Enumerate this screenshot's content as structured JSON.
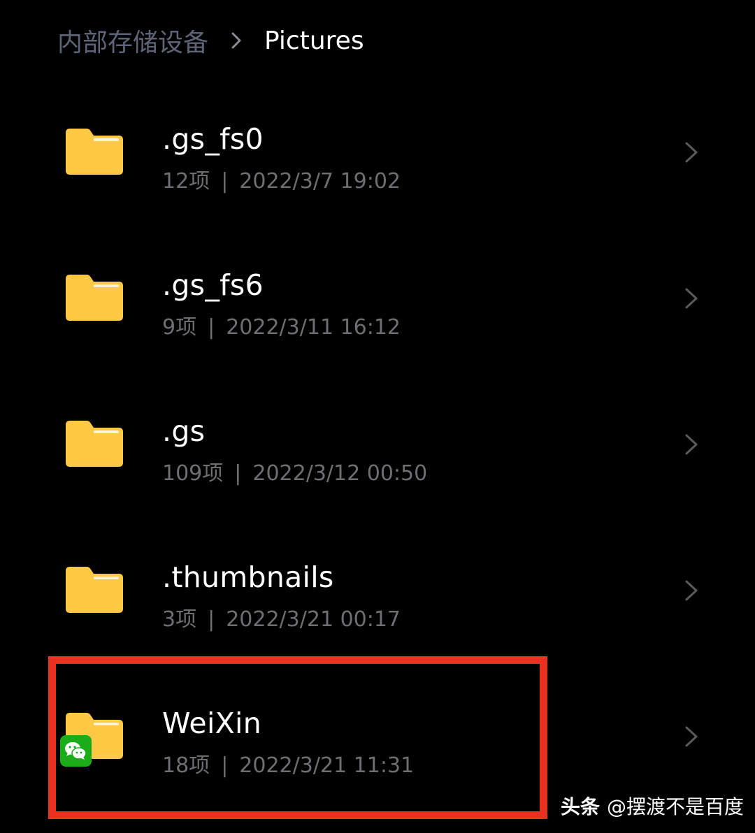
{
  "breadcrumb": {
    "root": "内部存储设备",
    "current": "Pictures"
  },
  "items": [
    {
      "name": ".gs_fs0",
      "count": "12项",
      "separator": "|",
      "date": "2022/3/7 19:02",
      "icon": "folder-icon"
    },
    {
      "name": ".gs_fs6",
      "count": "9项",
      "separator": "|",
      "date": "2022/3/11 16:12",
      "icon": "folder-icon"
    },
    {
      "name": ".gs",
      "count": "109项",
      "separator": "|",
      "date": "2022/3/12 00:50",
      "icon": "folder-icon"
    },
    {
      "name": ".thumbnails",
      "count": "3项",
      "separator": "|",
      "date": "2022/3/21 00:17",
      "icon": "folder-icon"
    },
    {
      "name": "WeiXin",
      "count": "18项",
      "separator": "|",
      "date": "2022/3/21 11:31",
      "icon": "folder-icon",
      "badge": "wechat-icon"
    }
  ],
  "watermark": {
    "brand": "头条",
    "handle": "@摆渡不是百度"
  },
  "colors": {
    "background": "#000000",
    "folder": "#ffc845",
    "folder_tab": "#f5b62f",
    "breadcrumb_root": "#5e6478",
    "meta_text": "#6e6e73",
    "chevron": "#5a5a5e",
    "highlight": "#e8321f",
    "wechat_green": "#1aad19"
  }
}
